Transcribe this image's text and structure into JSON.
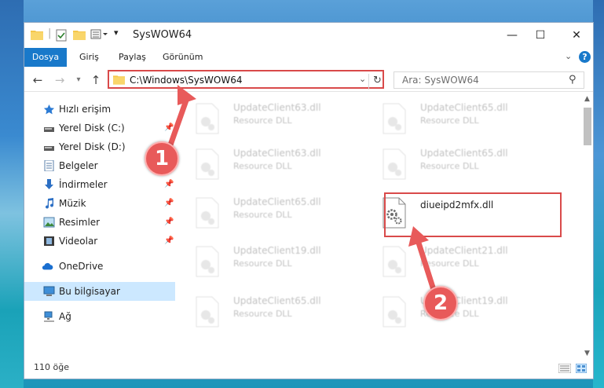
{
  "window": {
    "title": "SysWOW64",
    "minimize": "—",
    "maximize": "☐",
    "close": "✕"
  },
  "ribbon": {
    "tabs": [
      {
        "label": "Dosya",
        "active": true
      },
      {
        "label": "Giriş",
        "active": false
      },
      {
        "label": "Paylaş",
        "active": false
      },
      {
        "label": "Görünüm",
        "active": false
      }
    ]
  },
  "address_bar": {
    "path": "C:\\Windows\\SysWOW64",
    "search_placeholder": "Ara: SysWOW64"
  },
  "nav_pane": {
    "items": [
      {
        "label": "Hızlı erişim",
        "icon": "star-icon",
        "pinned": false
      },
      {
        "label": "Yerel Disk (C:)",
        "icon": "drive-icon",
        "pinned": true
      },
      {
        "label": "Yerel Disk (D:)",
        "icon": "drive-icon",
        "pinned": true
      },
      {
        "label": "Belgeler",
        "icon": "documents-icon",
        "pinned": true
      },
      {
        "label": "İndirmeler",
        "icon": "downloads-icon",
        "pinned": true
      },
      {
        "label": "Müzik",
        "icon": "music-icon",
        "pinned": true
      },
      {
        "label": "Resimler",
        "icon": "pictures-icon",
        "pinned": true
      },
      {
        "label": "Videolar",
        "icon": "videos-icon",
        "pinned": true
      },
      {
        "label": "OneDrive",
        "icon": "cloud-icon",
        "pinned": false
      },
      {
        "label": "Bu bilgisayar",
        "icon": "computer-icon",
        "pinned": false,
        "selected": true
      },
      {
        "label": "Ağ",
        "icon": "network-icon",
        "pinned": false
      }
    ]
  },
  "files": [
    {
      "name": "UpdateClient63.dll",
      "type": "Resource DLL",
      "faded": true
    },
    {
      "name": "UpdateClient65.dll",
      "type": "Resource DLL",
      "faded": true
    },
    {
      "name": "UpdateClient63.dll",
      "type": "Resource DLL",
      "faded": true
    },
    {
      "name": "UpdateClient65.dll",
      "type": "Resource DLL",
      "faded": true
    },
    {
      "name": "UpdateClient65.dll",
      "type": "Resource DLL",
      "faded": true
    },
    {
      "name": "diueipd2mfx.dll",
      "type": "",
      "faded": false
    },
    {
      "name": "UpdateClient19.dll",
      "type": "Resource DLL",
      "faded": true
    },
    {
      "name": "UpdateClient21.dll",
      "type": "Resource DLL",
      "faded": true
    },
    {
      "name": "UpdateClient65.dll",
      "type": "Resource DLL",
      "faded": true
    },
    {
      "name": "UpdateClient19.dll",
      "type": "Resource DLL",
      "faded": true
    }
  ],
  "status_bar": {
    "count": "110 öğe"
  },
  "annotations": {
    "step1": "1",
    "step2": "2"
  },
  "colors": {
    "accent": "#1979ca",
    "highlight": "#d94a4a",
    "selection": "#cce8ff"
  }
}
